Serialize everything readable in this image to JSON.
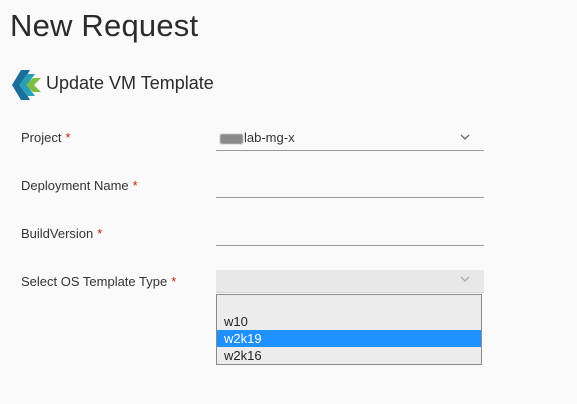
{
  "page": {
    "title": "New Request"
  },
  "catalog_item": {
    "name": "Update VM Template",
    "icon": "vm-template-logo-icon"
  },
  "form": {
    "required_marker": "*",
    "project": {
      "label": "Project",
      "value_suffix": "lab-mg-x",
      "value_prefix_redacted": true
    },
    "deployment_name": {
      "label": "Deployment Name",
      "value": ""
    },
    "build_version": {
      "label": "BuildVersion",
      "value": ""
    },
    "os_template_type": {
      "label": "Select OS Template Type",
      "value": "",
      "options": [
        "",
        "w10",
        "w2k19",
        "w2k16"
      ],
      "highlighted_option": "w2k19"
    }
  },
  "colors": {
    "required": "#c92100",
    "highlight": "#1e90ff",
    "logo_teal": "#2a9fb5",
    "logo_green": "#7cbd42"
  }
}
